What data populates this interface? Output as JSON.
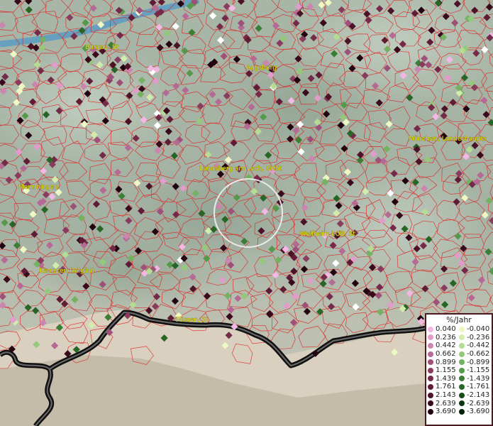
{
  "map": {
    "labels": [
      {
        "text": "Burgau, St",
        "pos": [
          120,
          69
        ]
      },
      {
        "text": "Augsburg",
        "pos": [
          347,
          98
        ]
      },
      {
        "text": "München, Landeshaupts",
        "pos": [
          576,
          198
        ]
      },
      {
        "text": "Landsberg am Lech, GKSt",
        "pos": [
          281,
          240
        ]
      },
      {
        "text": "Memmingen",
        "pos": [
          26,
          266
        ]
      },
      {
        "text": "Weilheim i.OB, St",
        "pos": [
          423,
          332
        ]
      },
      {
        "text": "Kempten (Allgäu)",
        "pos": [
          55,
          384
        ]
      },
      {
        "text": "Füssen, St",
        "pos": [
          248,
          453
        ]
      }
    ]
  },
  "legend": {
    "title": "%/Jahr",
    "positive": [
      {
        "value": "0.040",
        "color": "#f2b8e4"
      },
      {
        "value": "0.236",
        "color": "#e29ccc"
      },
      {
        "value": "0.442",
        "color": "#cc84b0"
      },
      {
        "value": "0.662",
        "color": "#b56a96"
      },
      {
        "value": "0.899",
        "color": "#9e5078"
      },
      {
        "value": "1.155",
        "color": "#893c5e"
      },
      {
        "value": "1.439",
        "color": "#742a48"
      },
      {
        "value": "1.761",
        "color": "#601c36"
      },
      {
        "value": "2.143",
        "color": "#4c1228"
      },
      {
        "value": "2.639",
        "color": "#380a1c"
      },
      {
        "value": "3.690",
        "color": "#220410"
      }
    ],
    "negative": [
      {
        "value": "-0.040",
        "color": "#eef8c2"
      },
      {
        "value": "-0.236",
        "color": "#d2ecac"
      },
      {
        "value": "-0.442",
        "color": "#b4dc92"
      },
      {
        "value": "-0.662",
        "color": "#94c87a"
      },
      {
        "value": "-0.899",
        "color": "#74b262"
      },
      {
        "value": "-1.155",
        "color": "#56994c"
      },
      {
        "value": "-1.439",
        "color": "#3c7e38"
      },
      {
        "value": "-1.761",
        "color": "#286628"
      },
      {
        "value": "-2.143",
        "color": "#184e1a"
      },
      {
        "value": "-2.639",
        "color": "#0c3810"
      },
      {
        "value": "-3.690",
        "color": "#042208"
      }
    ]
  }
}
